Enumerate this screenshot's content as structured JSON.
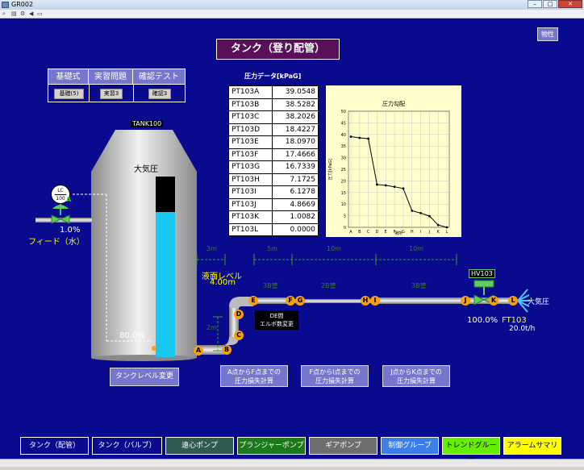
{
  "window": {
    "title": "GR002"
  },
  "header": {
    "title": "タンク（登り配管）",
    "property_button": "物性"
  },
  "modes": {
    "headers": [
      "基礎式",
      "実習問題",
      "確認テスト"
    ],
    "buttons": [
      "基礎(5)",
      "実習3",
      "確認3"
    ]
  },
  "tank": {
    "tag": "TANK100",
    "label": "大気圧",
    "level_percent": "80.0%",
    "level_fraction": 0.8
  },
  "level_controller": {
    "line1": "LC",
    "line2": "100",
    "valve_label": "A",
    "output": "1.0%",
    "feed_label": "フィード（水）"
  },
  "pressure_table": {
    "title": "圧力データ[kPaG]",
    "rows": [
      {
        "tag": "PT103A",
        "value": "39.0548"
      },
      {
        "tag": "PT103B",
        "value": "38.5282"
      },
      {
        "tag": "PT103C",
        "value": "38.2026"
      },
      {
        "tag": "PT103D",
        "value": "18.4227"
      },
      {
        "tag": "PT103E",
        "value": "18.0970"
      },
      {
        "tag": "PT103F",
        "value": "17.4666"
      },
      {
        "tag": "PT103G",
        "value": "16.7339"
      },
      {
        "tag": "PT103H",
        "value": "7.1725"
      },
      {
        "tag": "PT103I",
        "value": "6.1278"
      },
      {
        "tag": "PT103J",
        "value": "4.8669"
      },
      {
        "tag": "PT103K",
        "value": "1.0082"
      },
      {
        "tag": "PT103L",
        "value": "0.0000"
      }
    ]
  },
  "chart_data": {
    "type": "line",
    "title": "圧力勾配",
    "xlabel": "場所",
    "ylabel": "圧力[kPaG]",
    "categories": [
      "A",
      "B",
      "C",
      "D",
      "E",
      "F",
      "G",
      "H",
      "I",
      "J",
      "K",
      "L"
    ],
    "values": [
      39.0548,
      38.5282,
      38.2026,
      18.4227,
      18.097,
      17.4666,
      16.7339,
      7.1725,
      6.1278,
      4.8669,
      1.0082,
      0.0
    ],
    "ylim": [
      0,
      50
    ],
    "yticks": [
      "0",
      "5",
      "10",
      "15",
      "20",
      "25",
      "30",
      "35",
      "40",
      "45",
      "50"
    ],
    "grid": true
  },
  "piping": {
    "distances": [
      "3m",
      "5m",
      "10m",
      "10m"
    ],
    "height": "2m",
    "level_label": "液面レベル",
    "level_value": "4.00m",
    "pipe_labels": [
      "3B管",
      "2B管",
      "3B管"
    ],
    "nodes": [
      "A",
      "B",
      "C",
      "D",
      "E",
      "F",
      "G",
      "H",
      "I",
      "J",
      "K",
      "L"
    ],
    "de_note_line1": "DE間",
    "de_note_line2": "エルボ数変更",
    "valve_tag": "HV103",
    "valve_opening": "100.0%",
    "flow_tag": "FT103",
    "flow_value": "20.0t/h",
    "outlet_label": "大気圧"
  },
  "actions": {
    "tank_level_change": "タンクレベル変更",
    "calc_af_line1": "A点からF点までの",
    "calc_af_line2": "圧力損失計算",
    "calc_fi_line1": "F点からI点までの",
    "calc_fi_line2": "圧力損失計算",
    "calc_jk_line1": "J点からK点までの",
    "calc_jk_line2": "圧力損失計算"
  },
  "nav": [
    {
      "label": "タンク（配管）",
      "color": "#0a0a8f",
      "text": "#ffffff"
    },
    {
      "label": "タンク（バルブ）",
      "color": "#0a0a8f",
      "text": "#ffffff"
    },
    {
      "label": "遠心ポンプ",
      "color": "#2f5a4f",
      "text": "#ffffff"
    },
    {
      "label": "プランジャーポンプ",
      "color": "#1a7a1a",
      "text": "#ffffff"
    },
    {
      "label": "ギアポンプ",
      "color": "#6e6e6e",
      "text": "#ffffff"
    },
    {
      "label": "制御グループ",
      "color": "#3b7ee8",
      "text": "#ffffff"
    },
    {
      "label": "トレンドグループ",
      "color": "#66ee00",
      "text": "#000000"
    },
    {
      "label": "アラームサマリ",
      "color": "#ffff00",
      "text": "#000000"
    }
  ]
}
